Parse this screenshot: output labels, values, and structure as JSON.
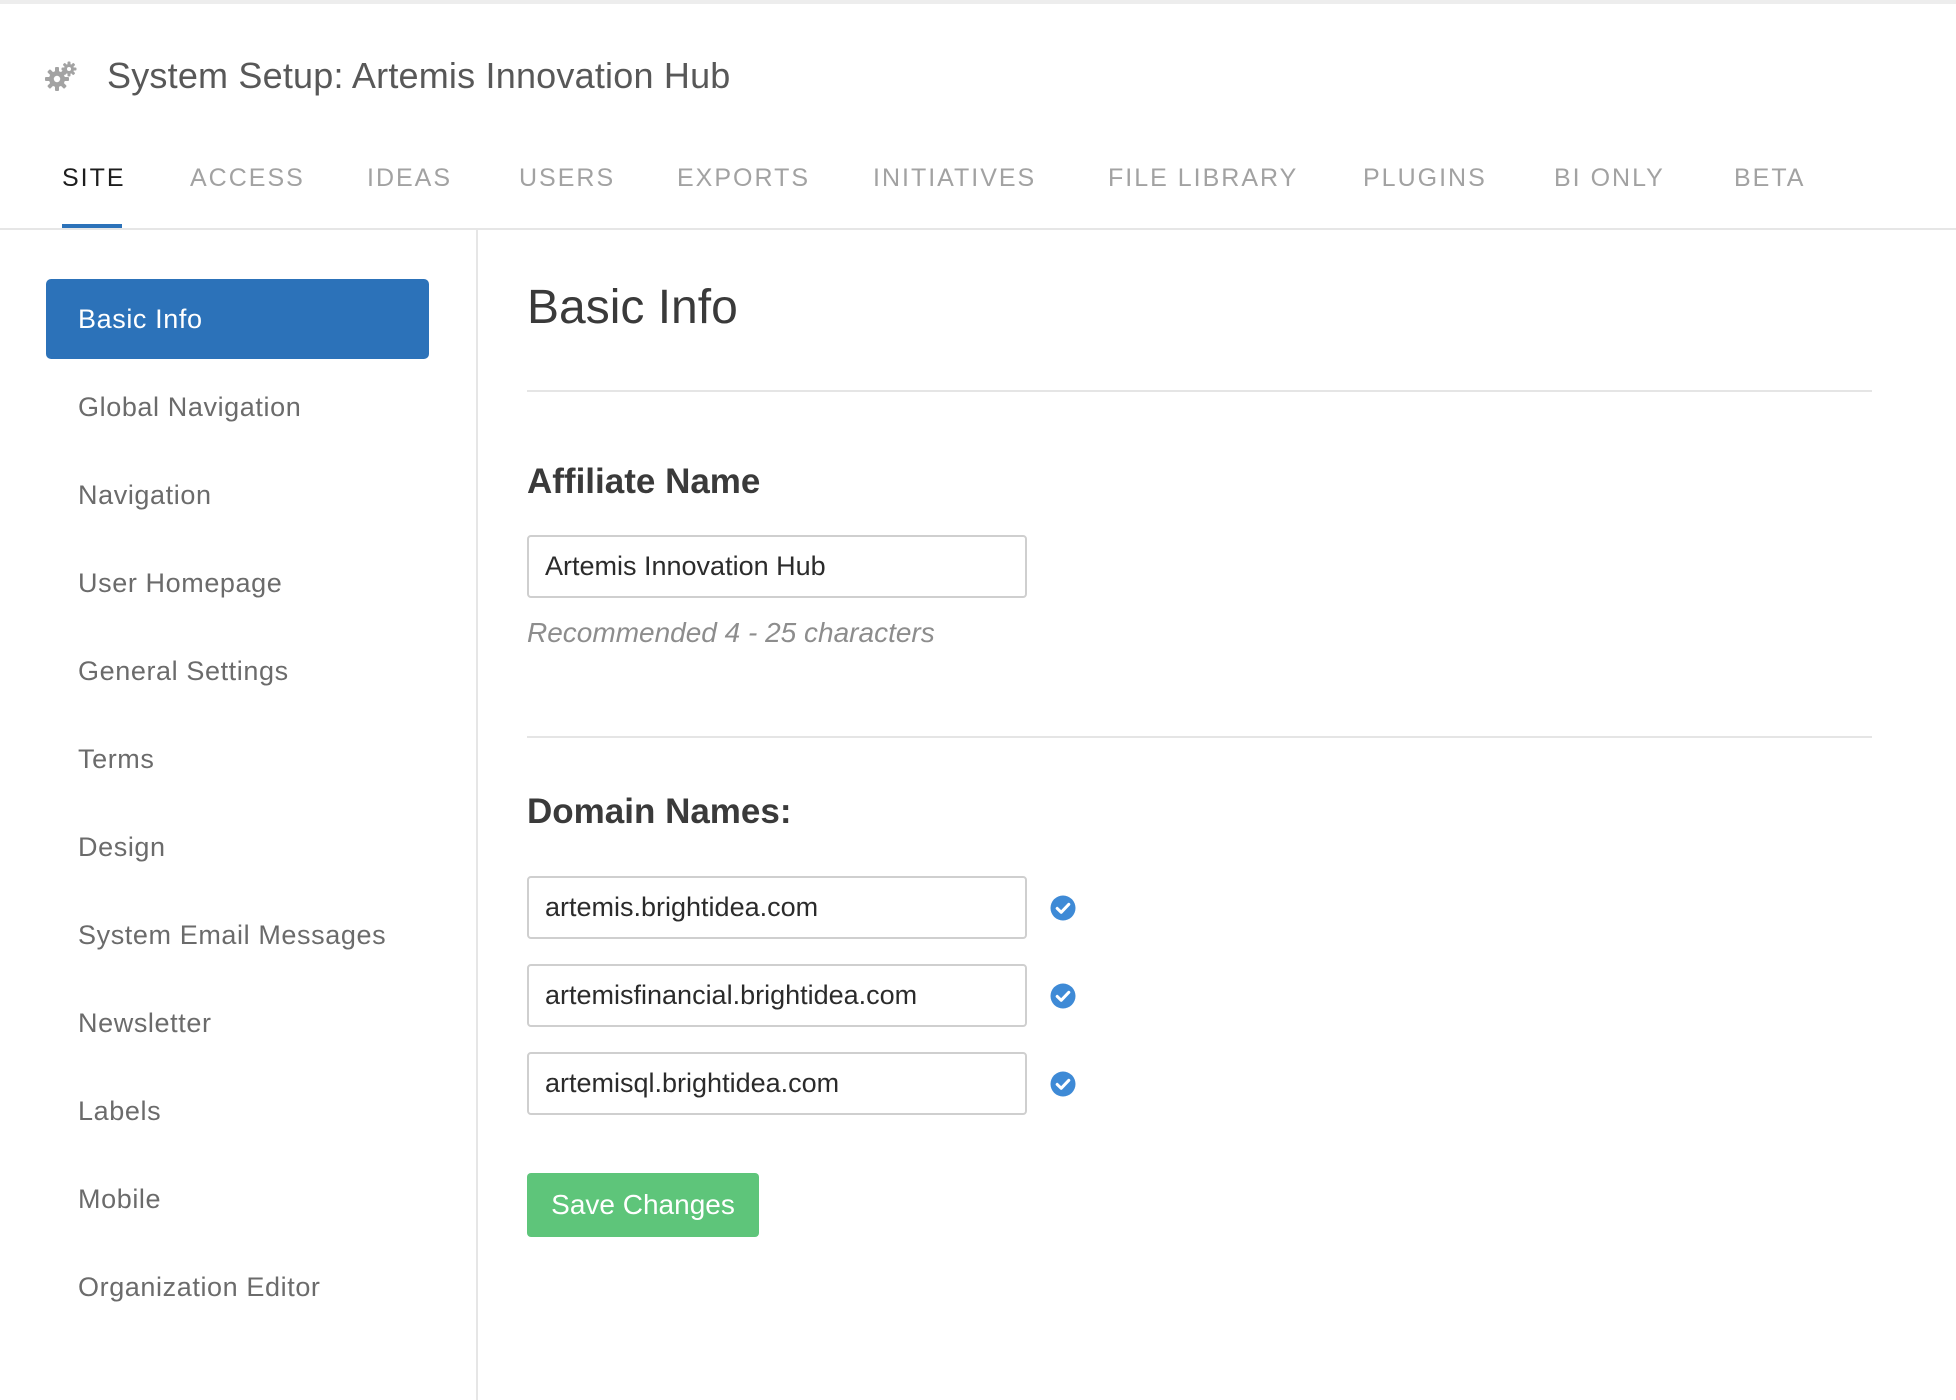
{
  "header": {
    "title": "System Setup: Artemis Innovation Hub",
    "icon": "gear-icon"
  },
  "tabs": [
    {
      "label": "SITE",
      "active": true
    },
    {
      "label": "ACCESS",
      "active": false
    },
    {
      "label": "IDEAS",
      "active": false
    },
    {
      "label": "USERS",
      "active": false
    },
    {
      "label": "EXPORTS",
      "active": false
    },
    {
      "label": "INITIATIVES",
      "active": false
    },
    {
      "label": "FILE LIBRARY",
      "active": false
    },
    {
      "label": "PLUGINS",
      "active": false
    },
    {
      "label": "BI ONLY",
      "active": false
    },
    {
      "label": "BETA",
      "active": false
    }
  ],
  "sidebar": {
    "items": [
      {
        "label": "Basic Info",
        "active": true
      },
      {
        "label": "Global Navigation",
        "active": false
      },
      {
        "label": "Navigation",
        "active": false
      },
      {
        "label": "User Homepage",
        "active": false
      },
      {
        "label": "General Settings",
        "active": false
      },
      {
        "label": "Terms",
        "active": false
      },
      {
        "label": "Design",
        "active": false
      },
      {
        "label": "System Email Messages",
        "active": false
      },
      {
        "label": "Newsletter",
        "active": false
      },
      {
        "label": "Labels",
        "active": false
      },
      {
        "label": "Mobile",
        "active": false
      },
      {
        "label": "Organization Editor",
        "active": false
      }
    ]
  },
  "main": {
    "title": "Basic Info",
    "affiliate": {
      "heading": "Affiliate Name",
      "value": "Artemis Innovation Hub",
      "hint": "Recommended 4 - 25 characters"
    },
    "domains": {
      "heading": "Domain Names:",
      "entries": [
        {
          "value": "artemis.brightidea.com",
          "verified_icon": "verified-check-icon"
        },
        {
          "value": "artemisfinancial.brightidea.com",
          "verified_icon": "verified-check-icon"
        },
        {
          "value": "artemisql.brightidea.com",
          "verified_icon": "verified-check-icon"
        }
      ]
    },
    "save_label": "Save Changes"
  },
  "colors": {
    "accent": "#2c72b9",
    "save_button": "#5ec57a",
    "verified_check": "#3e8ad6",
    "tab_inactive": "#a2a2a2",
    "tab_active": "#1d1d1d"
  }
}
